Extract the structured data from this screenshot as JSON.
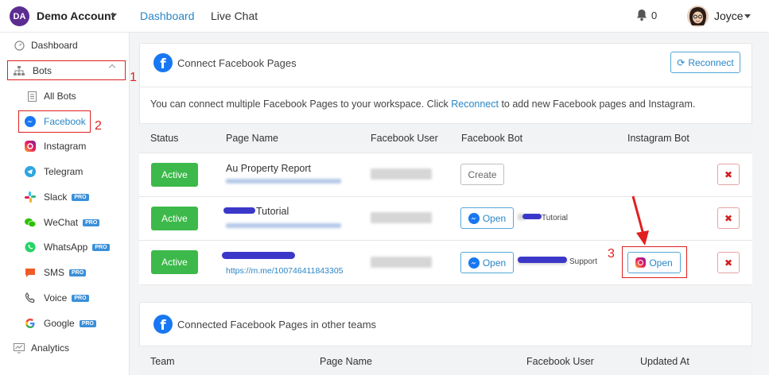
{
  "topbar": {
    "avatar_initials": "DA",
    "account_name": "Demo Account",
    "nav": [
      "Dashboard",
      "Live Chat"
    ],
    "notification_count": "0",
    "user_name": "Joyce"
  },
  "sidebar": {
    "items": [
      {
        "label": "Dashboard",
        "icon": "dashboard-icon"
      },
      {
        "label": "Bots",
        "icon": "sitemap-icon"
      },
      {
        "label": "All Bots",
        "icon": "document-icon"
      },
      {
        "label": "Facebook",
        "icon": "messenger-icon"
      },
      {
        "label": "Instagram",
        "icon": "instagram-icon"
      },
      {
        "label": "Telegram",
        "icon": "telegram-icon"
      },
      {
        "label": "Slack",
        "icon": "slack-icon",
        "badge": "PRO"
      },
      {
        "label": "WeChat",
        "icon": "wechat-icon",
        "badge": "PRO"
      },
      {
        "label": "WhatsApp",
        "icon": "whatsapp-icon",
        "badge": "PRO"
      },
      {
        "label": "SMS",
        "icon": "sms-icon",
        "badge": "PRO"
      },
      {
        "label": "Voice",
        "icon": "voice-icon",
        "badge": "PRO"
      },
      {
        "label": "Google",
        "icon": "google-icon",
        "badge": "PRO"
      },
      {
        "label": "Analytics",
        "icon": "analytics-icon"
      }
    ]
  },
  "annotations": [
    "1",
    "2",
    "3"
  ],
  "connect_card": {
    "title": "Connect Facebook Pages",
    "reconnect_label": "Reconnect",
    "info_prefix": "You can connect multiple Facebook Pages to your workspace. Click ",
    "info_link": "Reconnect",
    "info_suffix": " to add new Facebook pages and Instagram.",
    "columns": [
      "Status",
      "Page Name",
      "Facebook User",
      "Facebook Bot",
      "Instagram Bot"
    ],
    "rows": [
      {
        "status": "Active",
        "page_name": "Au Property Report",
        "page_link": "",
        "fb_bot": "Create",
        "bot_name": ""
      },
      {
        "status": "Active",
        "page_name": "Tutorial",
        "page_link": "",
        "fb_bot": "Open",
        "bot_name": "Tutorial"
      },
      {
        "status": "Active",
        "page_name": "",
        "page_link": "https://m.me/100746411843305",
        "fb_bot": "Open",
        "bot_name": "Support",
        "ig_bot": "Open"
      }
    ]
  },
  "other_card": {
    "title": "Connected Facebook Pages in other teams",
    "columns": [
      "Team",
      "Page Name",
      "Facebook User",
      "Updated At"
    ]
  },
  "colors": {
    "accent": "#2a86c6",
    "active": "#3cb94a",
    "annotation": "#e02020",
    "brand": "#5c2d91"
  }
}
